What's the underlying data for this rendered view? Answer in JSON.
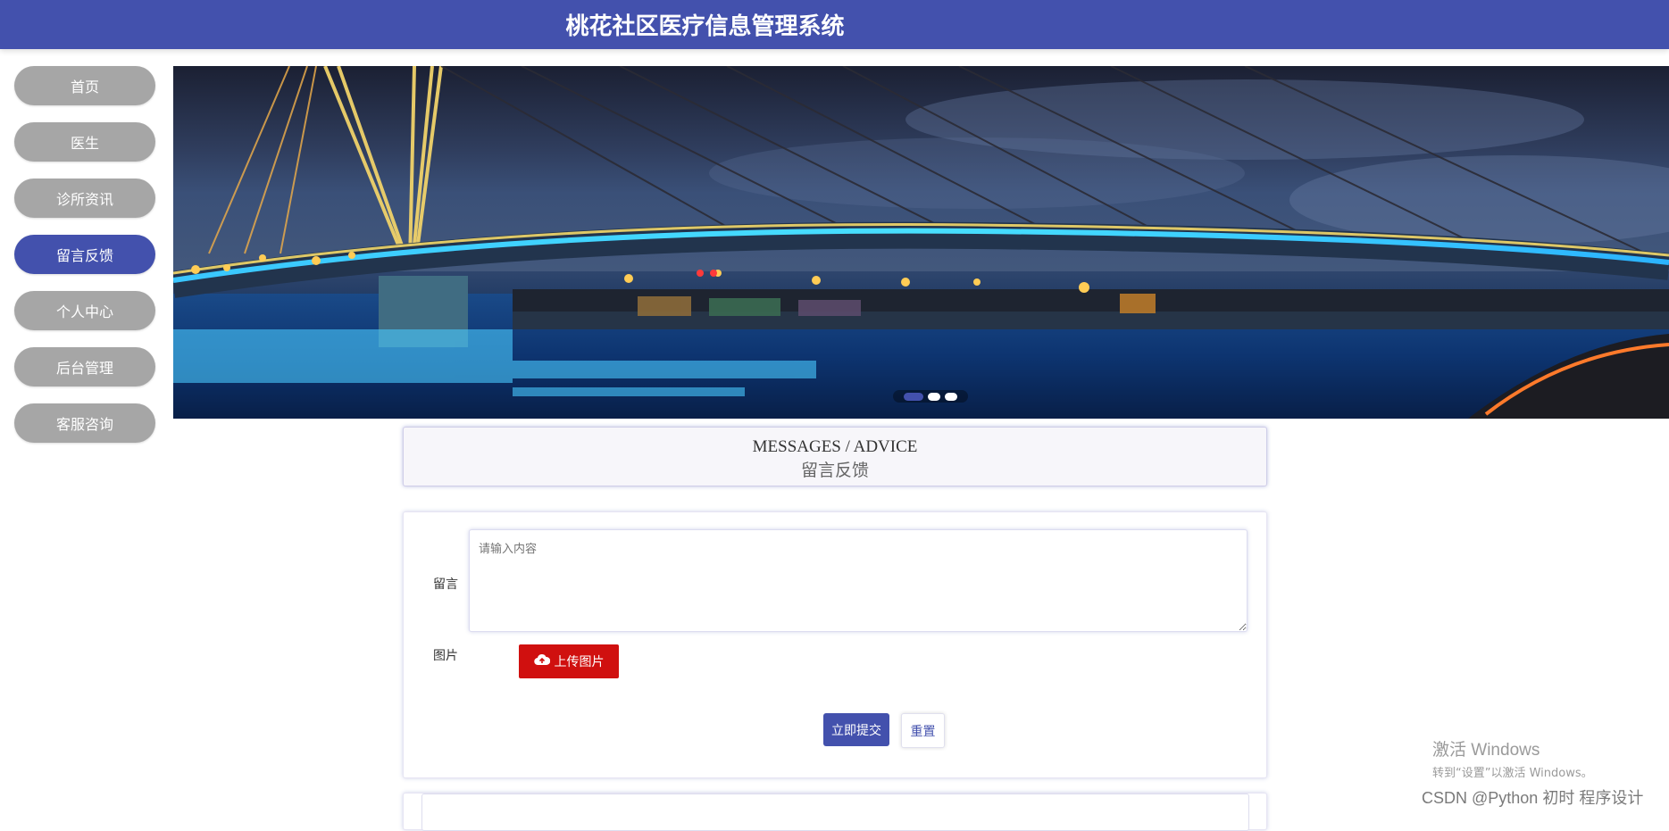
{
  "header": {
    "title": "桃花社区医疗信息管理系统"
  },
  "sidebar": {
    "items": [
      {
        "label": "首页"
      },
      {
        "label": "医生"
      },
      {
        "label": "诊所资讯"
      },
      {
        "label": "留言反馈",
        "active": true
      },
      {
        "label": "个人中心"
      },
      {
        "label": "后台管理"
      },
      {
        "label": "客服咨询"
      }
    ]
  },
  "banner": {
    "slides": 3,
    "active_slide": 1
  },
  "section": {
    "title_en": "MESSAGES / ADVICE",
    "title_cn": "留言反馈"
  },
  "form": {
    "message_label": "留言",
    "message_placeholder": "请输入内容",
    "image_label": "图片",
    "upload_label": "上传图片",
    "submit_label": "立即提交",
    "reset_label": "重置"
  },
  "watermark": {
    "title": "激活 Windows",
    "subtitle": "转到“设置”以激活 Windows。",
    "credit": "CSDN @Python 初时 程序设计"
  },
  "colors": {
    "primary": "#4351ad",
    "upload": "#d0100f",
    "nav_inactive": "#a6a6a6"
  }
}
